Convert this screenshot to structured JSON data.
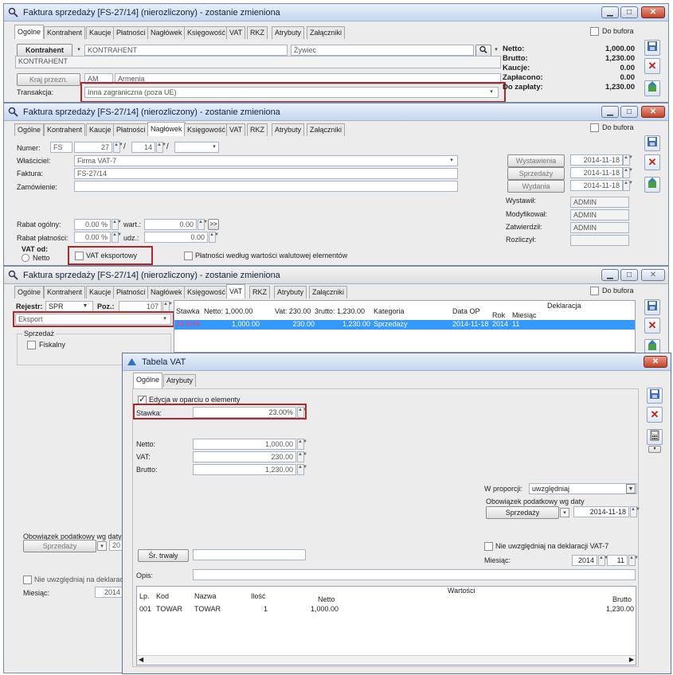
{
  "w1": {
    "title": "Faktura sprzedaży [FS-27/14] (nierozliczony) - zostanie zmieniona",
    "tabs": [
      "Ogólne",
      "Kontrahent",
      "Kaucje",
      "Płatności",
      "Nagłówek",
      "Księgowość",
      "VAT",
      "RKZ",
      "Atrybuty",
      "Załączniki"
    ],
    "do_bufora": "Do bufora",
    "kontrahent_btn": "Kontrahent",
    "kontrahent_code": "KONTRAHENT",
    "kontrahent_city": "Żywiec",
    "kontrahent_name": "KONTRAHENT",
    "kraj_btn": "Kraj przezn.",
    "kraj_code": "AM",
    "kraj_name": "Armenia",
    "transakcja_label": "Transakcja:",
    "transakcja_value": "Inna zagraniczna (poza UE)",
    "summary": [
      {
        "label": "Netto:",
        "value": "1,000.00"
      },
      {
        "label": "Brutto:",
        "value": "1,230.00"
      },
      {
        "label": "Kaucje:",
        "value": "0.00"
      },
      {
        "label": "Zapłacono:",
        "value": "0.00"
      },
      {
        "label": "Do zapłaty:",
        "value": "1,230.00"
      }
    ]
  },
  "w2": {
    "title": "Faktura sprzedaży [FS-27/14] (nierozliczony) - zostanie zmieniona",
    "tabs": [
      "Ogólne",
      "Kontrahent",
      "Kaucje",
      "Płatności",
      "Nagłówek",
      "Księgowość",
      "VAT",
      "RKZ",
      "Atrybuty",
      "Załączniki"
    ],
    "do_bufora": "Do bufora",
    "numer_label": "Numer:",
    "numer_prefix": "FS",
    "numer_num": "27",
    "numer_year": "14",
    "slash1": "/",
    "slash2": "/",
    "wlasciciel_label": "Właściciel:",
    "wlasciciel": "Firma VAT-7",
    "faktura_label": "Faktura:",
    "faktura": "FS-27/14",
    "zamowienie_label": "Zamówienie:",
    "btn_wystawienia": "Wystawienia",
    "btn_sprzedazy": "Sprzedaży",
    "btn_wydania": "Wydania",
    "date_wystawienia": "2014-11-18",
    "date_sprzedazy": "2014-11-18",
    "date_wydania": "2014-11-18",
    "wystawil_label": "Wystawił:",
    "wystawil": "ADMIN",
    "modyfikowal_label": "Modyfikował:",
    "modyfikowal": "ADMIN",
    "zatwierdzil_label": "Zatwierdził:",
    "zatwierdzil": "ADMIN",
    "rozliczyl_label": "Rozliczył:",
    "rabat_ogolny_label": "Rabat ogólny:",
    "rabat_ogolny": "0.00 %",
    "wart_label": "wart.:",
    "wart": "0.00",
    "more": ">>",
    "rabat_platnosci_label": "Rabat płatności:",
    "rabat_platnosci": "0.00 %",
    "udz_label": "udz.:",
    "udz": "0.00",
    "vat_od_label": "VAT od:",
    "vat_netto": "Netto",
    "vat_eksportowy": "VAT eksportowy",
    "platnosci_walutowe": "Płatności według wartości walutowej elementów"
  },
  "w3": {
    "title": "Faktura sprzedaży [FS-27/14] (nierozliczony) - zostanie zmieniona",
    "tabs": [
      "Ogólne",
      "Kontrahent",
      "Kaucje",
      "Płatności",
      "Nagłówek",
      "Księgowość",
      "VAT",
      "RKZ",
      "Atrybuty",
      "Załączniki"
    ],
    "do_bufora": "Do bufora",
    "rejestr_label": "Rejestr:",
    "rejestr": "SPR",
    "poz_label": "Poz.:",
    "poz": "107",
    "eksport": "Eksport",
    "sprzedaz_group": "Sprzedaż",
    "fiskalny": "Fiskalny",
    "grid_headers": {
      "stawka": "Stawka",
      "netto": "Netto: 1,000.00",
      "vat": "Vat: 230.00",
      "brutto": "3rutto: 1,230.00",
      "kategoria": "Kategoria",
      "data_op": "Data OP",
      "deklaracja": "Deklaracja",
      "rok": "Rok",
      "miesiac": "Miesiąc"
    },
    "grid_row": {
      "stawka": "23.00%",
      "netto": "1,000.00",
      "vat": "230.00",
      "brutto": "1,230.00",
      "kategoria": "Sprzedaży",
      "data_op": "2014-11-18",
      "rok": "2014",
      "miesiac": "11"
    },
    "obowiazek_label": "Obowiązek podatkowy wg daty",
    "btn_sprzedazy": "Sprzedaży",
    "obowiazek_date": "20",
    "nie_uwzgledniaj": "Nie uwzględniaj na deklaracji",
    "miesiac_label": "Miesiąc:",
    "miesiac_year": "2014"
  },
  "w4": {
    "title": "Tabela VAT",
    "tabs": [
      "Ogólne",
      "Atrybuty"
    ],
    "edycja": "Edycja w oparciu o elementy",
    "stawka_label": "Stawka:",
    "stawka": "23.00%",
    "netto_label": "Netto:",
    "netto": "1,000.00",
    "vat_label": "VAT:",
    "vat": "230.00",
    "brutto_label": "Brutto:",
    "brutto": "1,230.00",
    "w_proporcji_label": "W proporcji:",
    "w_proporcji": "uwzględniaj",
    "obowiazek_label": "Obowiązek podatkowy wg daty",
    "btn_sprzedazy": "Sprzedaży",
    "obowiazek_date": "2014-11-18",
    "nie_uwzgledniaj": "Nie uwzględniaj na deklaracji VAT-7",
    "miesiac_label": "Miesiąc:",
    "miesiac_year": "2014",
    "miesiac_month": "11",
    "sr_trwaly": "Śr. trwały",
    "opis_label": "Opis:",
    "grid_headers": {
      "lp": "Lp.",
      "kod": "Kod",
      "nazwa": "Nazwa",
      "ilosc": "Ilość",
      "wartosci": "Wartości",
      "netto": "Netto",
      "brutto": "Brutto"
    },
    "grid_row": {
      "lp": "001",
      "kod": "TOWAR",
      "nazwa": "TOWAR",
      "ilosc": "1",
      "netto": "1,000.00",
      "brutto": "1,230.00"
    }
  }
}
